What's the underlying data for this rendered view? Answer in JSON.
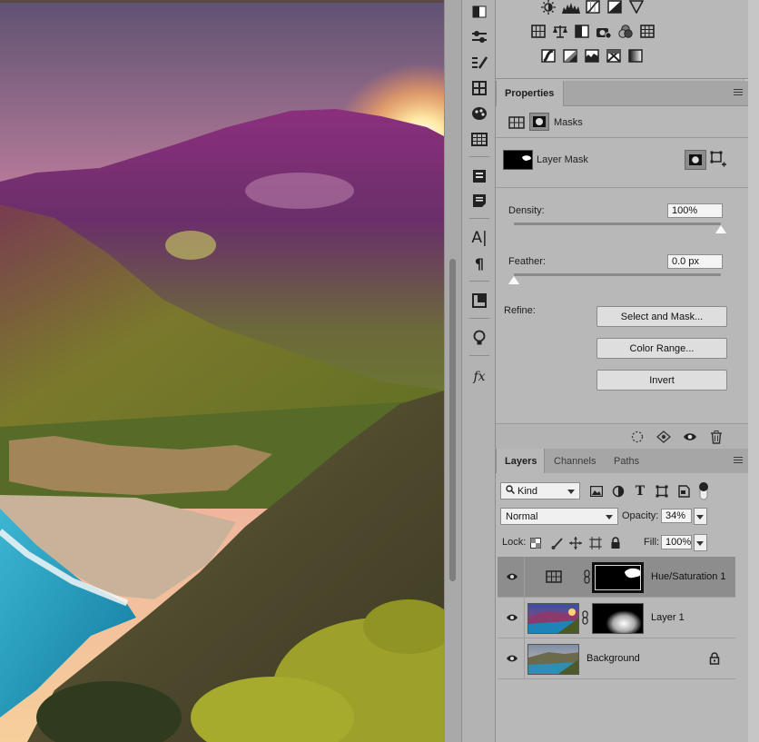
{
  "properties": {
    "tabs": [
      {
        "label": "Properties",
        "active": true
      }
    ],
    "section_label": "Masks",
    "mask_type": "Layer Mask",
    "density": {
      "label": "Density:",
      "value": "100%",
      "level_percent": 100
    },
    "feather": {
      "label": "Feather:",
      "value": "0.0 px",
      "level_percent": 0
    },
    "refine": {
      "label": "Refine:",
      "buttons": [
        "Select and Mask...",
        "Color Range...",
        "Invert"
      ]
    },
    "footer_icons": [
      "load-selection-icon",
      "apply-mask-icon",
      "visibility-eye-icon",
      "trash-icon"
    ]
  },
  "adjustments": {
    "icons": [
      "brightness-contrast-icon",
      "levels-icon",
      "curves-icon",
      "exposure-icon",
      "vibrance-icon",
      "hue-saturation-icon",
      "color-balance-icon",
      "black-white-icon",
      "photo-filter-icon",
      "channel-mixer-icon",
      "color-lookup-icon",
      "invert-icon",
      "posterize-icon",
      "threshold-icon",
      "selective-color-icon",
      "gradient-map-icon"
    ]
  },
  "tools": [
    "gradient-panel-icon",
    "adjustments-sliders-icon",
    "brush-settings-icon",
    "clone-source-icon",
    "color-swatches-icon",
    "grid-table-icon",
    "libraries-icon",
    "notes-icon",
    "character-icon",
    "paragraph-icon",
    "glyphs-icon",
    "bulb-icon",
    "fx-styles-icon"
  ],
  "layers": {
    "tabs": [
      {
        "label": "Layers",
        "active": true
      },
      {
        "label": "Channels",
        "active": false
      },
      {
        "label": "Paths",
        "active": false
      }
    ],
    "filter": {
      "value": "Kind"
    },
    "blend_mode": {
      "value": "Normal"
    },
    "opacity": {
      "label": "Opacity:",
      "value": "34%"
    },
    "lock": {
      "label": "Lock:"
    },
    "fill": {
      "label": "Fill:",
      "value": "100%"
    },
    "items": [
      {
        "name": "Hue/Saturation 1",
        "visible": true,
        "selected": true,
        "kind": "adjustment",
        "has_mask": true
      },
      {
        "name": "Layer 1",
        "visible": true,
        "selected": false,
        "kind": "pixel",
        "has_mask": true
      },
      {
        "name": "Background",
        "visible": true,
        "selected": false,
        "kind": "background",
        "locked": true
      }
    ]
  },
  "colors": {
    "panel_bg": "#b8b8b8",
    "tabbar_bg": "#a6a6a6",
    "selected_layer": "#8d8d8d",
    "field_bg": "#f4f4f4",
    "button_bg": "#dedede"
  }
}
